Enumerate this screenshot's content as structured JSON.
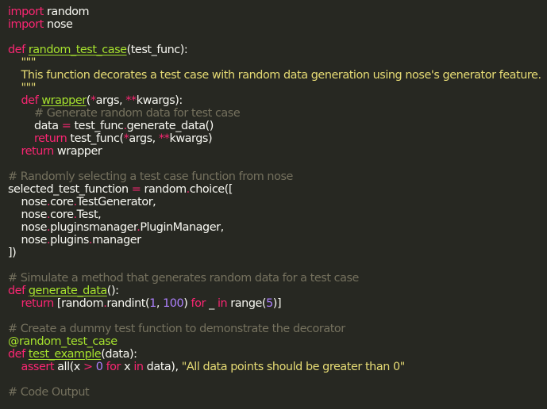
{
  "colors": {
    "background": "#272822",
    "default": "#F8F8F2",
    "keyword": "#F92672",
    "function_name": "#A6E22E",
    "string": "#E6DB74",
    "comment": "#75715E",
    "number": "#AE81FF",
    "operator": "#F92672",
    "decorator": "#A6E22E"
  },
  "editor": {
    "lines": [
      [
        {
          "t": "kw",
          "v": "import"
        },
        {
          "t": "pun",
          "v": " random"
        }
      ],
      [
        {
          "t": "kw",
          "v": "import"
        },
        {
          "t": "pun",
          "v": " nose"
        }
      ],
      [],
      [
        {
          "t": "kw",
          "v": "def"
        },
        {
          "t": "pun",
          "v": " "
        },
        {
          "t": "fn",
          "v": "random_test_case"
        },
        {
          "t": "pun",
          "v": "(test_func):"
        }
      ],
      [
        {
          "t": "pun",
          "v": "    "
        },
        {
          "t": "str",
          "v": "\"\"\""
        }
      ],
      [
        {
          "t": "str",
          "v": "    This function decorates a test case with random data generation using nose's generator feature."
        }
      ],
      [
        {
          "t": "pun",
          "v": "    "
        },
        {
          "t": "str",
          "v": "\"\"\""
        }
      ],
      [
        {
          "t": "pun",
          "v": "    "
        },
        {
          "t": "kw",
          "v": "def"
        },
        {
          "t": "pun",
          "v": " "
        },
        {
          "t": "fn",
          "v": "wrapper"
        },
        {
          "t": "pun",
          "v": "("
        },
        {
          "t": "op",
          "v": "*"
        },
        {
          "t": "pun",
          "v": "args, "
        },
        {
          "t": "op",
          "v": "**"
        },
        {
          "t": "pun",
          "v": "kwargs):"
        }
      ],
      [
        {
          "t": "pun",
          "v": "        "
        },
        {
          "t": "cm",
          "v": "# Generate random data for test case"
        }
      ],
      [
        {
          "t": "pun",
          "v": "        data "
        },
        {
          "t": "op",
          "v": "="
        },
        {
          "t": "pun",
          "v": " test_func"
        },
        {
          "t": "op",
          "v": "."
        },
        {
          "t": "pun",
          "v": "generate_data()"
        }
      ],
      [
        {
          "t": "pun",
          "v": "        "
        },
        {
          "t": "kw",
          "v": "return"
        },
        {
          "t": "pun",
          "v": " test_func("
        },
        {
          "t": "op",
          "v": "*"
        },
        {
          "t": "pun",
          "v": "args, "
        },
        {
          "t": "op",
          "v": "**"
        },
        {
          "t": "pun",
          "v": "kwargs)"
        }
      ],
      [
        {
          "t": "pun",
          "v": "    "
        },
        {
          "t": "kw",
          "v": "return"
        },
        {
          "t": "pun",
          "v": " wrapper"
        }
      ],
      [],
      [
        {
          "t": "cm",
          "v": "# Randomly selecting a test case function from nose"
        }
      ],
      [
        {
          "t": "pun",
          "v": "selected_test_function "
        },
        {
          "t": "op",
          "v": "="
        },
        {
          "t": "pun",
          "v": " random"
        },
        {
          "t": "op",
          "v": "."
        },
        {
          "t": "pun",
          "v": "choice(["
        }
      ],
      [
        {
          "t": "pun",
          "v": "    nose"
        },
        {
          "t": "op",
          "v": "."
        },
        {
          "t": "pun",
          "v": "core"
        },
        {
          "t": "op",
          "v": "."
        },
        {
          "t": "pun",
          "v": "TestGenerator,"
        }
      ],
      [
        {
          "t": "pun",
          "v": "    nose"
        },
        {
          "t": "op",
          "v": "."
        },
        {
          "t": "pun",
          "v": "core"
        },
        {
          "t": "op",
          "v": "."
        },
        {
          "t": "pun",
          "v": "Test,"
        }
      ],
      [
        {
          "t": "pun",
          "v": "    nose"
        },
        {
          "t": "op",
          "v": "."
        },
        {
          "t": "pun",
          "v": "pluginsmanager"
        },
        {
          "t": "op",
          "v": "."
        },
        {
          "t": "pun",
          "v": "PluginManager,"
        }
      ],
      [
        {
          "t": "pun",
          "v": "    nose"
        },
        {
          "t": "op",
          "v": "."
        },
        {
          "t": "pun",
          "v": "plugins"
        },
        {
          "t": "op",
          "v": "."
        },
        {
          "t": "pun",
          "v": "manager"
        }
      ],
      [
        {
          "t": "pun",
          "v": "])"
        }
      ],
      [],
      [
        {
          "t": "cm",
          "v": "# Simulate a method that generates random data for a test case"
        }
      ],
      [
        {
          "t": "kw",
          "v": "def"
        },
        {
          "t": "pun",
          "v": " "
        },
        {
          "t": "fn",
          "v": "generate_data"
        },
        {
          "t": "pun",
          "v": "():"
        }
      ],
      [
        {
          "t": "pun",
          "v": "    "
        },
        {
          "t": "kw",
          "v": "return"
        },
        {
          "t": "pun",
          "v": " [random"
        },
        {
          "t": "op",
          "v": "."
        },
        {
          "t": "pun",
          "v": "randint("
        },
        {
          "t": "num",
          "v": "1"
        },
        {
          "t": "pun",
          "v": ", "
        },
        {
          "t": "num",
          "v": "100"
        },
        {
          "t": "pun",
          "v": ") "
        },
        {
          "t": "kw",
          "v": "for"
        },
        {
          "t": "pun",
          "v": " _ "
        },
        {
          "t": "kw",
          "v": "in"
        },
        {
          "t": "pun",
          "v": " range("
        },
        {
          "t": "num",
          "v": "5"
        },
        {
          "t": "pun",
          "v": ")]"
        }
      ],
      [],
      [
        {
          "t": "cm",
          "v": "# Create a dummy test function to demonstrate the decorator"
        }
      ],
      [
        {
          "t": "dec",
          "v": "@random_test_case"
        }
      ],
      [
        {
          "t": "kw",
          "v": "def"
        },
        {
          "t": "pun",
          "v": " "
        },
        {
          "t": "fn",
          "v": "test_example"
        },
        {
          "t": "pun",
          "v": "(data):"
        }
      ],
      [
        {
          "t": "pun",
          "v": "    "
        },
        {
          "t": "kw",
          "v": "assert"
        },
        {
          "t": "pun",
          "v": " all(x "
        },
        {
          "t": "op",
          "v": ">"
        },
        {
          "t": "pun",
          "v": " "
        },
        {
          "t": "num",
          "v": "0"
        },
        {
          "t": "pun",
          "v": " "
        },
        {
          "t": "kw",
          "v": "for"
        },
        {
          "t": "pun",
          "v": " x "
        },
        {
          "t": "kw",
          "v": "in"
        },
        {
          "t": "pun",
          "v": " data), "
        },
        {
          "t": "str",
          "v": "\"All data points should be greater than 0\""
        }
      ],
      [],
      [
        {
          "t": "cm",
          "v": "# Code Output"
        }
      ]
    ]
  }
}
